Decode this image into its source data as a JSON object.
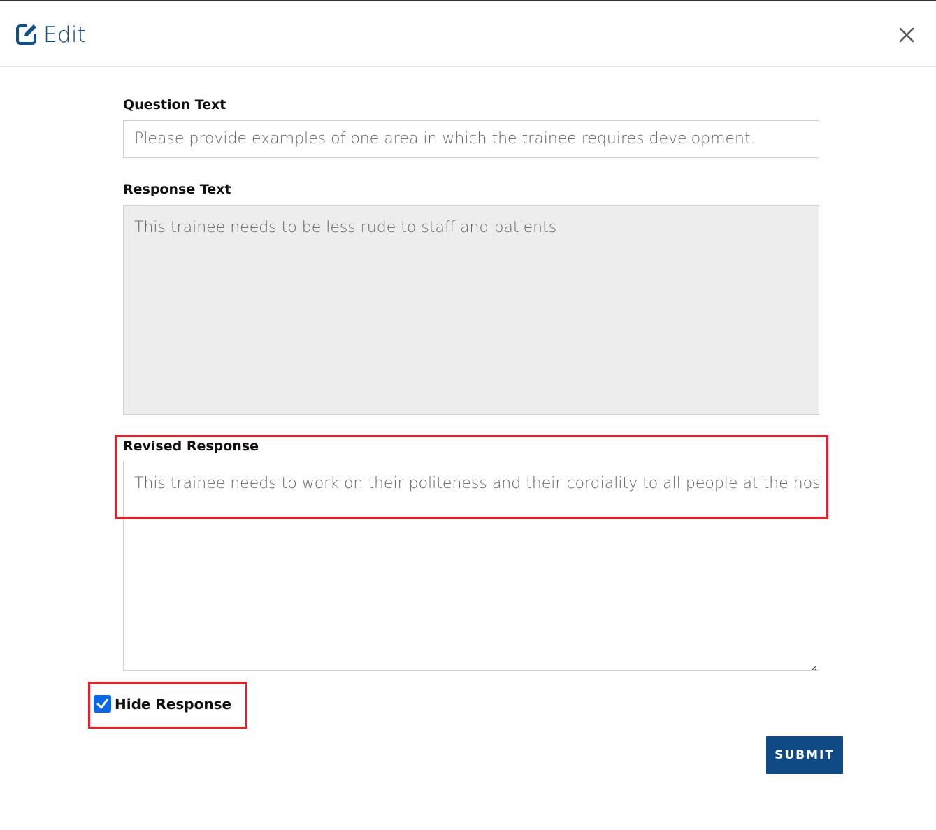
{
  "header": {
    "title": "Edit",
    "edit_icon": "edit-square-icon",
    "close_icon": "close-icon"
  },
  "form": {
    "question_label": "Question Text",
    "question_value": "Please provide examples of one area in which the trainee requires development.",
    "response_label": "Response Text",
    "response_value": "This trainee needs to be less rude to staff and patients",
    "revised_label": "Revised Response",
    "revised_value": "This trainee needs to work on their politeness and their cordiality to all people at the hospital.",
    "hide_response_label": "Hide Response",
    "hide_response_checked": true,
    "submit_label": "SUBMIT"
  },
  "colors": {
    "accent": "#0f4f8a",
    "submit_bg": "#0f4a85",
    "highlight": "#e0202a",
    "checkbox": "#0b66e4",
    "readonly_bg": "#ededed"
  }
}
